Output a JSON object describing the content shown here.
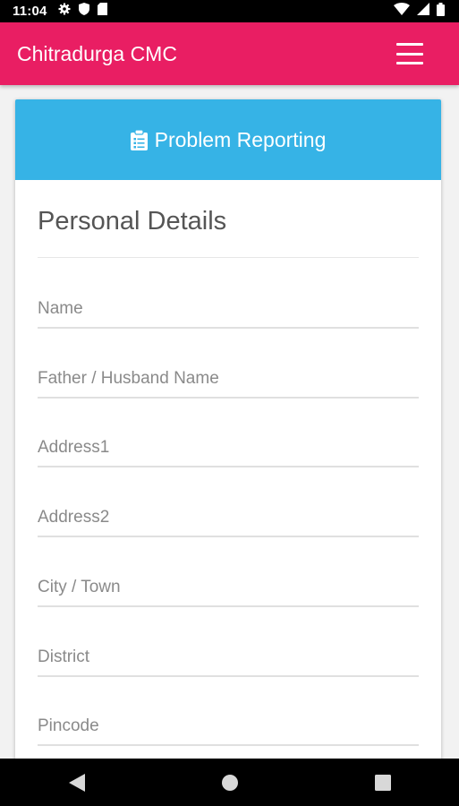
{
  "status_bar": {
    "time": "11:04",
    "left_icons": [
      "gear-icon",
      "shield-icon",
      "sd-card-icon"
    ],
    "right_icons": [
      "wifi-icon",
      "signal-icon",
      "battery-icon"
    ]
  },
  "app_bar": {
    "title": "Chitradurga CMC",
    "menu_icon": "hamburger-menu-icon",
    "color": "#e91e63"
  },
  "card": {
    "header_title": "Problem Reporting",
    "header_icon": "clipboard-icon",
    "header_color": "#36b3e6",
    "section_title": "Personal Details",
    "fields": [
      {
        "placeholder": "Name"
      },
      {
        "placeholder": "Father / Husband Name"
      },
      {
        "placeholder": "Address1"
      },
      {
        "placeholder": "Address2"
      },
      {
        "placeholder": "City / Town"
      },
      {
        "placeholder": "District"
      },
      {
        "placeholder": "Pincode"
      }
    ]
  },
  "nav_bar": {
    "buttons": [
      "back-icon",
      "home-icon",
      "recents-icon"
    ]
  }
}
